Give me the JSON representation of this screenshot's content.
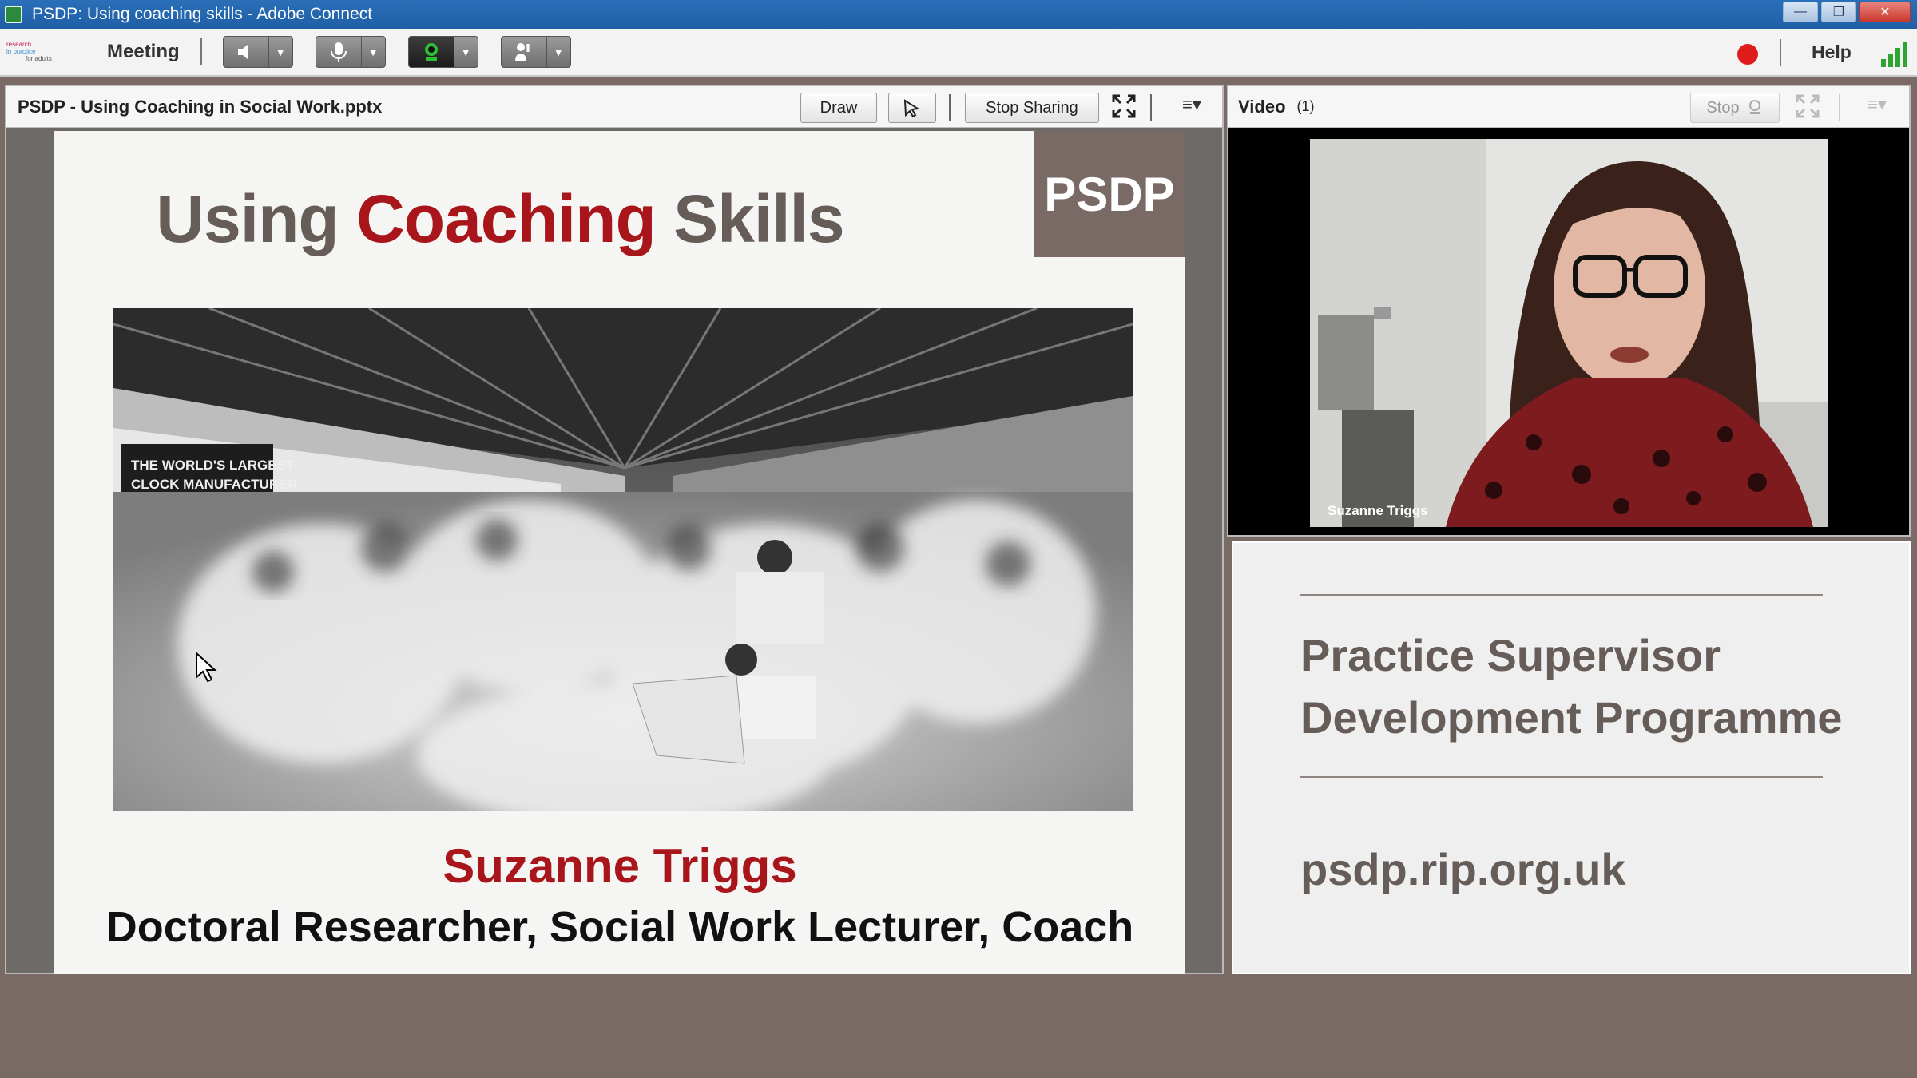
{
  "window": {
    "title": "PSDP: Using coaching skills - Adobe Connect",
    "controls": {
      "minimize": "—",
      "restore": "❐",
      "close": "✕"
    }
  },
  "menubar": {
    "logo_lines": [
      "research",
      "in practice",
      "for adults"
    ],
    "meeting_label": "Meeting",
    "tools": [
      {
        "name": "speaker",
        "icon": "speaker-icon",
        "glyph": "◀"
      },
      {
        "name": "microphone",
        "icon": "microphone-icon",
        "glyph": "🎙"
      },
      {
        "name": "camera",
        "icon": "webcam-icon",
        "glyph": "●"
      },
      {
        "name": "raise-hand",
        "icon": "hand-icon",
        "glyph": "✋"
      }
    ],
    "help_label": "Help",
    "recording_color": "#e01b1b"
  },
  "share_pod": {
    "title": "PSDP - Using Coaching in Social Work.pptx",
    "draw_label": "Draw",
    "stop_sharing_label": "Stop Sharing",
    "slide": {
      "title_part1": "Using ",
      "title_accent": "Coaching",
      "title_part2": " Skills",
      "logo_text": "PSDP",
      "photo_sign": "THE WORLD'S LARGEST CLOCK MANUFACTURER",
      "name": "Suzanne Triggs",
      "role": "Doctoral Researcher, Social Work Lecturer, Coach"
    }
  },
  "video_pod": {
    "title": "Video",
    "count": "(1)",
    "stop_label": "Stop",
    "participant_name": "Suzanne Triggs"
  },
  "notes_pod": {
    "title_line1": "Practice Supervisor",
    "title_line2": "Development Programme",
    "url": "psdp.rip.org.uk"
  },
  "colors": {
    "accent_red": "#a8151b",
    "brand_taupe": "#7a6a65",
    "title_bar_blue": "#2a6fb8"
  }
}
